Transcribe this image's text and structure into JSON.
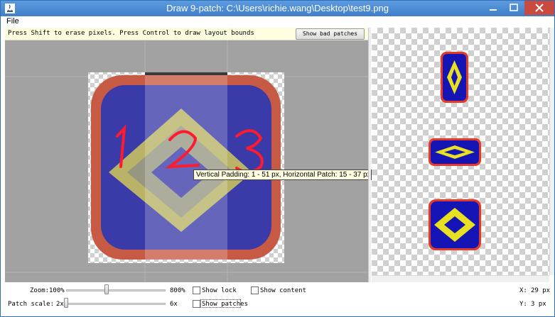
{
  "window": {
    "title": "Draw 9-patch: C:\\Users\\richie.wang\\Desktop\\test9.png"
  },
  "menu": {
    "file": "File"
  },
  "info_bar": {
    "text": "Press Shift to erase pixels. Press Control to draw layout bounds",
    "bad_patches_label": "Show bad patches"
  },
  "editor": {
    "annotations": [
      "1",
      "2",
      "3"
    ]
  },
  "tooltip": {
    "text": "Vertical Padding: 1 - 51 px, Horizontal Patch: 15 - 37 px"
  },
  "controls": {
    "zoom": {
      "label": "Zoom:",
      "min": "100%",
      "max": "800%",
      "value_fraction": 0.33
    },
    "patch_scale": {
      "label": "Patch scale:",
      "min": "2x",
      "max": "6x",
      "value_fraction": 0.0
    },
    "show_lock": {
      "label": "Show lock",
      "checked": false
    },
    "show_content": {
      "label": "Show content",
      "checked": false
    },
    "show_patches": {
      "label": "Show patches",
      "checked": false
    },
    "x_readout": {
      "label": "X:",
      "value": "29 px"
    },
    "y_readout": {
      "label": "Y:",
      "value": "3 px"
    }
  },
  "colors": {
    "frame_red": "#d4503a",
    "fill_blue": "#2a2ab0",
    "diamond_yellow": "#e8e020",
    "annotation_red": "#ff1a2e"
  },
  "icons": [
    "java-app-icon",
    "minimize-icon",
    "maximize-icon",
    "close-icon"
  ]
}
